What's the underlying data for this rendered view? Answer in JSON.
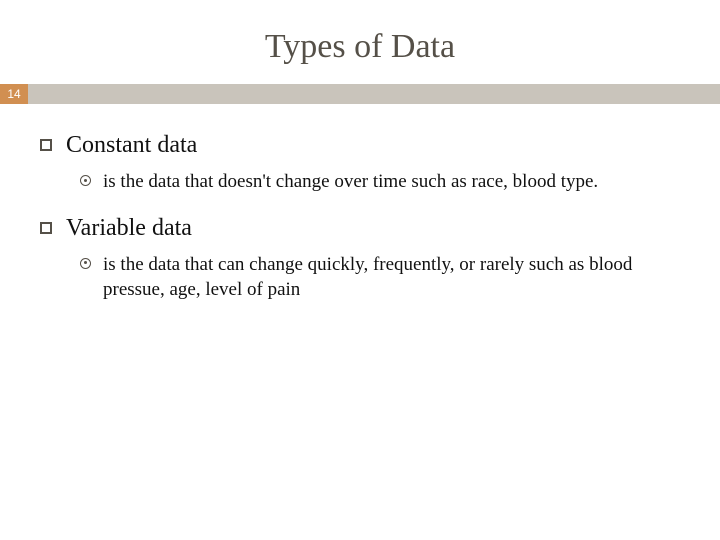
{
  "slide": {
    "title": "Types of Data",
    "page_number": "14",
    "items": [
      {
        "heading": "Constant data",
        "detail": " is the data that doesn't change over time such as race, blood type."
      },
      {
        "heading": "Variable data",
        "detail": " is the data that can change quickly, frequently, or rarely such as blood pressue, age, level of pain"
      }
    ]
  }
}
